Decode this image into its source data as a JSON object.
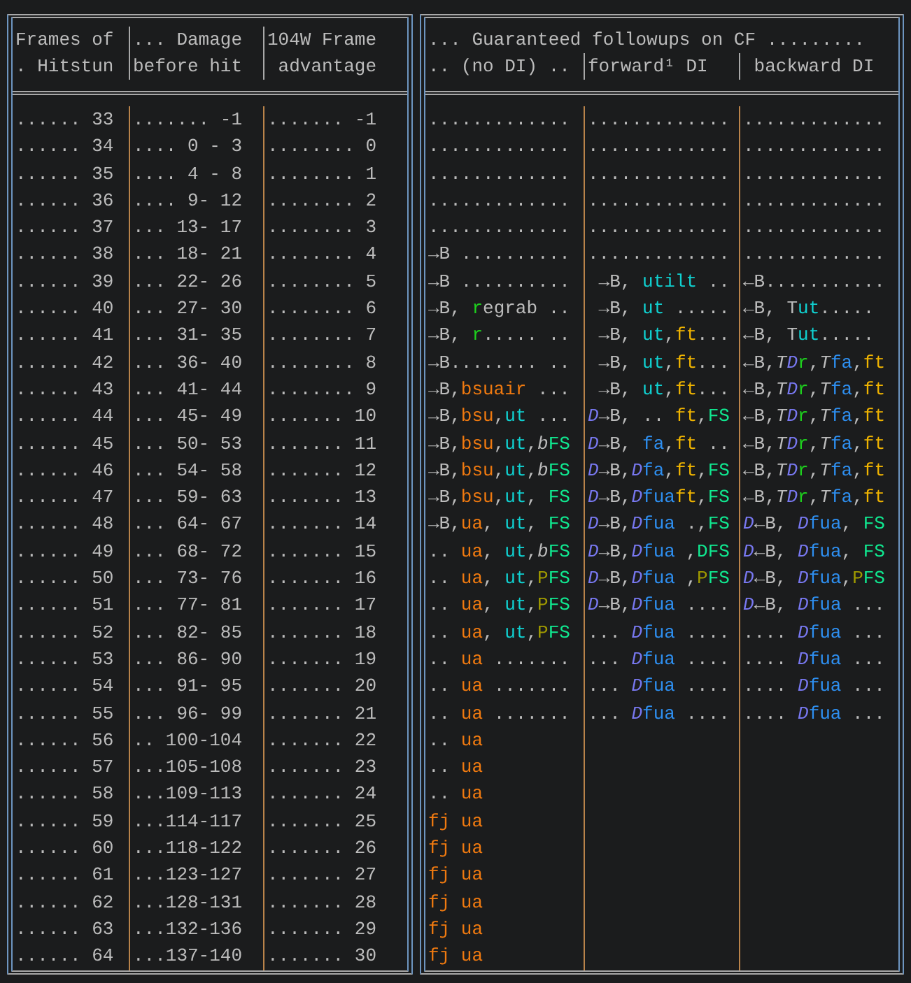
{
  "left_table": {
    "columns": [
      {
        "line_1": "Frames of",
        "line_2": ". Hitstun"
      },
      {
        "line_1": "... Damage",
        "line_2": "before hit"
      },
      {
        "line_1": "104W Frame",
        "line_2": " advantage"
      }
    ]
  },
  "right_table": {
    "title": "... Guaranteed followups on CF .........",
    "columns": [
      ".. (no DI) ..",
      "forward¹ DI",
      " backward DI"
    ]
  },
  "rows": [
    {
      "hitstun": "...... 33",
      "damage": "....... -1",
      "advantage": "....... -1",
      "no_di": [
        {
          "text": ".............",
          "color": "#bcbcbc"
        }
      ],
      "forward_di": [
        {
          "text": ".............",
          "color": "#bcbcbc"
        }
      ],
      "backward_di": [
        {
          "text": ".............",
          "color": "#bcbcbc"
        }
      ]
    },
    {
      "hitstun": "...... 34",
      "damage": ".... 0 - 3",
      "advantage": "........ 0",
      "no_di": [
        {
          "text": ".............",
          "color": "#bcbcbc"
        }
      ],
      "forward_di": [
        {
          "text": ".............",
          "color": "#bcbcbc"
        }
      ],
      "backward_di": [
        {
          "text": ".............",
          "color": "#bcbcbc"
        }
      ]
    },
    {
      "hitstun": "...... 35",
      "damage": ".... 4 - 8",
      "advantage": "........ 1",
      "no_di": [
        {
          "text": ".............",
          "color": "#bcbcbc"
        }
      ],
      "forward_di": [
        {
          "text": ".............",
          "color": "#bcbcbc"
        }
      ],
      "backward_di": [
        {
          "text": ".............",
          "color": "#bcbcbc"
        }
      ]
    },
    {
      "hitstun": "...... 36",
      "damage": ".... 9- 12",
      "advantage": "........ 2",
      "no_di": [
        {
          "text": ".............",
          "color": "#bcbcbc"
        }
      ],
      "forward_di": [
        {
          "text": ".............",
          "color": "#bcbcbc"
        }
      ],
      "backward_di": [
        {
          "text": ".............",
          "color": "#bcbcbc"
        }
      ]
    },
    {
      "hitstun": "...... 37",
      "damage": "... 13- 17",
      "advantage": "........ 3",
      "no_di": [
        {
          "text": ".............",
          "color": "#bcbcbc"
        }
      ],
      "forward_di": [
        {
          "text": ".............",
          "color": "#bcbcbc"
        }
      ],
      "backward_di": [
        {
          "text": ".............",
          "color": "#bcbcbc"
        }
      ]
    },
    {
      "hitstun": "...... 38",
      "damage": "... 18- 21",
      "advantage": "........ 4",
      "no_di": [
        {
          "text": "→B ..........",
          "color": "#bcbcbc"
        }
      ],
      "forward_di": [
        {
          "text": ".............",
          "color": "#bcbcbc"
        }
      ],
      "backward_di": [
        {
          "text": ".............",
          "color": "#bcbcbc"
        }
      ]
    },
    {
      "hitstun": "...... 39",
      "damage": "... 22- 26",
      "advantage": "........ 5",
      "no_di": [
        {
          "text": "→B ..........",
          "color": "#bcbcbc"
        }
      ],
      "forward_di": [
        {
          "text": " →B, ",
          "color": "#bcbcbc"
        },
        {
          "text": "utilt",
          "color": "#10d0d0"
        },
        {
          "text": " ..",
          "color": "#bcbcbc"
        }
      ],
      "backward_di": [
        {
          "text": "←B...........",
          "color": "#bcbcbc"
        }
      ]
    },
    {
      "hitstun": "...... 40",
      "damage": "... 27- 30",
      "advantage": "........ 6",
      "no_di": [
        {
          "text": "→B, ",
          "color": "#bcbcbc"
        },
        {
          "text": "r",
          "color": "#1ed01e"
        },
        {
          "text": "egrab ..",
          "color": "#bcbcbc"
        }
      ],
      "forward_di": [
        {
          "text": " →B, ",
          "color": "#bcbcbc"
        },
        {
          "text": "ut",
          "color": "#10d0d0"
        },
        {
          "text": " .....",
          "color": "#bcbcbc"
        }
      ],
      "backward_di": [
        {
          "text": "←B, T",
          "color": "#bcbcbc"
        },
        {
          "text": "ut",
          "color": "#10d0d0"
        },
        {
          "text": ".....",
          "color": "#bcbcbc"
        }
      ]
    },
    {
      "hitstun": "...... 41",
      "damage": "... 31- 35",
      "advantage": "........ 7",
      "no_di": [
        {
          "text": "→B, ",
          "color": "#bcbcbc"
        },
        {
          "text": "r",
          "color": "#1ed01e"
        },
        {
          "text": "..... ..",
          "color": "#bcbcbc"
        }
      ],
      "forward_di": [
        {
          "text": " →B, ",
          "color": "#bcbcbc"
        },
        {
          "text": "ut",
          "color": "#10d0d0"
        },
        {
          "text": ",",
          "color": "#bcbcbc"
        },
        {
          "text": "ft",
          "color": "#f0b400"
        },
        {
          "text": "...",
          "color": "#bcbcbc"
        }
      ],
      "backward_di": [
        {
          "text": "←B, T",
          "color": "#bcbcbc"
        },
        {
          "text": "ut",
          "color": "#10d0d0"
        },
        {
          "text": ".....",
          "color": "#bcbcbc"
        }
      ]
    },
    {
      "hitstun": "...... 42",
      "damage": "... 36- 40",
      "advantage": "........ 8",
      "no_di": [
        {
          "text": "→B........ ..",
          "color": "#bcbcbc"
        }
      ],
      "forward_di": [
        {
          "text": " →B, ",
          "color": "#bcbcbc"
        },
        {
          "text": "ut",
          "color": "#10d0d0"
        },
        {
          "text": ",",
          "color": "#bcbcbc"
        },
        {
          "text": "ft",
          "color": "#f0b400"
        },
        {
          "text": "...",
          "color": "#bcbcbc"
        }
      ],
      "backward_di": [
        {
          "text": "←B,*T*",
          "color": "#bcbcbc"
        },
        {
          "text": "*D*",
          "color": "#7878f0"
        },
        {
          "text": "r",
          "color": "#1ed01e"
        },
        {
          "text": ",*T*",
          "color": "#bcbcbc"
        },
        {
          "text": "fa",
          "color": "#2e8ff0"
        },
        {
          "text": ",",
          "color": "#bcbcbc"
        },
        {
          "text": "ft",
          "color": "#f0b400"
        }
      ]
    },
    {
      "hitstun": "...... 43",
      "damage": "... 41- 44",
      "advantage": "........ 9",
      "no_di": [
        {
          "text": "→B,",
          "color": "#bcbcbc"
        },
        {
          "text": "bsuair",
          "color": "#f07a10"
        },
        {
          "text": " ...",
          "color": "#bcbcbc"
        }
      ],
      "forward_di": [
        {
          "text": " →B, ",
          "color": "#bcbcbc"
        },
        {
          "text": "ut",
          "color": "#10d0d0"
        },
        {
          "text": ",",
          "color": "#bcbcbc"
        },
        {
          "text": "ft",
          "color": "#f0b400"
        },
        {
          "text": "...",
          "color": "#bcbcbc"
        }
      ],
      "backward_di": [
        {
          "text": "←B,*T*",
          "color": "#bcbcbc"
        },
        {
          "text": "*D*",
          "color": "#7878f0"
        },
        {
          "text": "r",
          "color": "#1ed01e"
        },
        {
          "text": ",*T*",
          "color": "#bcbcbc"
        },
        {
          "text": "fa",
          "color": "#2e8ff0"
        },
        {
          "text": ",",
          "color": "#bcbcbc"
        },
        {
          "text": "ft",
          "color": "#f0b400"
        }
      ]
    },
    {
      "hitstun": "...... 44",
      "damage": "... 45- 49",
      "advantage": "....... 10",
      "no_di": [
        {
          "text": "→B,",
          "color": "#bcbcbc"
        },
        {
          "text": "bsu",
          "color": "#f07a10"
        },
        {
          "text": ",",
          "color": "#bcbcbc"
        },
        {
          "text": "ut",
          "color": "#10d0d0"
        },
        {
          "text": " ...",
          "color": "#bcbcbc"
        }
      ],
      "forward_di": [
        {
          "text": "*D*",
          "color": "#7878f0"
        },
        {
          "text": "→B, .. ",
          "color": "#bcbcbc"
        },
        {
          "text": "ft",
          "color": "#f0b400"
        },
        {
          "text": ",",
          "color": "#bcbcbc"
        },
        {
          "text": "FS",
          "color": "#10e890"
        }
      ],
      "backward_di": [
        {
          "text": "←B,*T*",
          "color": "#bcbcbc"
        },
        {
          "text": "*D*",
          "color": "#7878f0"
        },
        {
          "text": "r",
          "color": "#1ed01e"
        },
        {
          "text": ",*T*",
          "color": "#bcbcbc"
        },
        {
          "text": "fa",
          "color": "#2e8ff0"
        },
        {
          "text": ",",
          "color": "#bcbcbc"
        },
        {
          "text": "ft",
          "color": "#f0b400"
        }
      ]
    },
    {
      "hitstun": "...... 45",
      "damage": "... 50- 53",
      "advantage": "....... 11",
      "no_di": [
        {
          "text": "→B,",
          "color": "#bcbcbc"
        },
        {
          "text": "bsu",
          "color": "#f07a10"
        },
        {
          "text": ",",
          "color": "#bcbcbc"
        },
        {
          "text": "ut",
          "color": "#10d0d0"
        },
        {
          "text": ",*b*",
          "color": "#bcbcbc"
        },
        {
          "text": "FS",
          "color": "#10e890"
        }
      ],
      "forward_di": [
        {
          "text": "*D*",
          "color": "#7878f0"
        },
        {
          "text": "→B, ",
          "color": "#bcbcbc"
        },
        {
          "text": "fa",
          "color": "#2e8ff0"
        },
        {
          "text": ",",
          "color": "#bcbcbc"
        },
        {
          "text": "ft",
          "color": "#f0b400"
        },
        {
          "text": " ..",
          "color": "#bcbcbc"
        }
      ],
      "backward_di": [
        {
          "text": "←B,*T*",
          "color": "#bcbcbc"
        },
        {
          "text": "*D*",
          "color": "#7878f0"
        },
        {
          "text": "r",
          "color": "#1ed01e"
        },
        {
          "text": ",*T*",
          "color": "#bcbcbc"
        },
        {
          "text": "fa",
          "color": "#2e8ff0"
        },
        {
          "text": ",",
          "color": "#bcbcbc"
        },
        {
          "text": "ft",
          "color": "#f0b400"
        }
      ]
    },
    {
      "hitstun": "...... 46",
      "damage": "... 54- 58",
      "advantage": "....... 12",
      "no_di": [
        {
          "text": "→B,",
          "color": "#bcbcbc"
        },
        {
          "text": "bsu",
          "color": "#f07a10"
        },
        {
          "text": ",",
          "color": "#bcbcbc"
        },
        {
          "text": "ut",
          "color": "#10d0d0"
        },
        {
          "text": ",*b*",
          "color": "#bcbcbc"
        },
        {
          "text": "FS",
          "color": "#10e890"
        }
      ],
      "forward_di": [
        {
          "text": "*D*",
          "color": "#7878f0"
        },
        {
          "text": "→B,",
          "color": "#bcbcbc"
        },
        {
          "text": "*D*",
          "color": "#7878f0"
        },
        {
          "text": "fa",
          "color": "#2e8ff0"
        },
        {
          "text": ",",
          "color": "#bcbcbc"
        },
        {
          "text": "ft",
          "color": "#f0b400"
        },
        {
          "text": ",",
          "color": "#bcbcbc"
        },
        {
          "text": "FS",
          "color": "#10e890"
        }
      ],
      "backward_di": [
        {
          "text": "←B,*T*",
          "color": "#bcbcbc"
        },
        {
          "text": "*D*",
          "color": "#7878f0"
        },
        {
          "text": "r",
          "color": "#1ed01e"
        },
        {
          "text": ",*T*",
          "color": "#bcbcbc"
        },
        {
          "text": "fa",
          "color": "#2e8ff0"
        },
        {
          "text": ",",
          "color": "#bcbcbc"
        },
        {
          "text": "ft",
          "color": "#f0b400"
        }
      ]
    },
    {
      "hitstun": "...... 47",
      "damage": "... 59- 63",
      "advantage": "....... 13",
      "no_di": [
        {
          "text": "→B,",
          "color": "#bcbcbc"
        },
        {
          "text": "bsu",
          "color": "#f07a10"
        },
        {
          "text": ",",
          "color": "#bcbcbc"
        },
        {
          "text": "ut",
          "color": "#10d0d0"
        },
        {
          "text": ", ",
          "color": "#bcbcbc"
        },
        {
          "text": "FS",
          "color": "#10e890"
        }
      ],
      "forward_di": [
        {
          "text": "*D*",
          "color": "#7878f0"
        },
        {
          "text": "→B,",
          "color": "#bcbcbc"
        },
        {
          "text": "*D*",
          "color": "#7878f0"
        },
        {
          "text": "fua",
          "color": "#2e8ff0"
        },
        {
          "text": "ft",
          "color": "#f0b400"
        },
        {
          "text": ",",
          "color": "#bcbcbc"
        },
        {
          "text": "FS",
          "color": "#10e890"
        }
      ],
      "backward_di": [
        {
          "text": "←B,*T*",
          "color": "#bcbcbc"
        },
        {
          "text": "*D*",
          "color": "#7878f0"
        },
        {
          "text": "r",
          "color": "#1ed01e"
        },
        {
          "text": ",*T*",
          "color": "#bcbcbc"
        },
        {
          "text": "fa",
          "color": "#2e8ff0"
        },
        {
          "text": ",",
          "color": "#bcbcbc"
        },
        {
          "text": "ft",
          "color": "#f0b400"
        }
      ]
    },
    {
      "hitstun": "...... 48",
      "damage": "... 64- 67",
      "advantage": "....... 14",
      "no_di": [
        {
          "text": "→B,",
          "color": "#bcbcbc"
        },
        {
          "text": "ua",
          "color": "#f07a10"
        },
        {
          "text": ", ",
          "color": "#bcbcbc"
        },
        {
          "text": "ut",
          "color": "#10d0d0"
        },
        {
          "text": ", ",
          "color": "#bcbcbc"
        },
        {
          "text": "FS",
          "color": "#10e890"
        }
      ],
      "forward_di": [
        {
          "text": "*D*",
          "color": "#7878f0"
        },
        {
          "text": "→B,",
          "color": "#bcbcbc"
        },
        {
          "text": "*D*",
          "color": "#7878f0"
        },
        {
          "text": "fua",
          "color": "#2e8ff0"
        },
        {
          "text": " .,",
          "color": "#bcbcbc"
        },
        {
          "text": "FS",
          "color": "#10e890"
        }
      ],
      "backward_di": [
        {
          "text": "*D*",
          "color": "#7878f0"
        },
        {
          "text": "←B, ",
          "color": "#bcbcbc"
        },
        {
          "text": "*D*",
          "color": "#7878f0"
        },
        {
          "text": "fua",
          "color": "#2e8ff0"
        },
        {
          "text": ", ",
          "color": "#bcbcbc"
        },
        {
          "text": "FS",
          "color": "#10e890"
        }
      ]
    },
    {
      "hitstun": "...... 49",
      "damage": "... 68- 72",
      "advantage": "....... 15",
      "no_di": [
        {
          "text": ".. ",
          "color": "#bcbcbc"
        },
        {
          "text": "ua",
          "color": "#f07a10"
        },
        {
          "text": ", ",
          "color": "#bcbcbc"
        },
        {
          "text": "ut",
          "color": "#10d0d0"
        },
        {
          "text": ",*b*",
          "color": "#bcbcbc"
        },
        {
          "text": "FS",
          "color": "#10e890"
        }
      ],
      "forward_di": [
        {
          "text": "*D*",
          "color": "#7878f0"
        },
        {
          "text": "→B,",
          "color": "#bcbcbc"
        },
        {
          "text": "*D*",
          "color": "#7878f0"
        },
        {
          "text": "fua",
          "color": "#2e8ff0"
        },
        {
          "text": " ,",
          "color": "#bcbcbc"
        },
        {
          "text": "DFS",
          "color": "#10e890"
        }
      ],
      "backward_di": [
        {
          "text": "*D*",
          "color": "#7878f0"
        },
        {
          "text": "←B, ",
          "color": "#bcbcbc"
        },
        {
          "text": "*D*",
          "color": "#7878f0"
        },
        {
          "text": "fua",
          "color": "#2e8ff0"
        },
        {
          "text": ", ",
          "color": "#bcbcbc"
        },
        {
          "text": "FS",
          "color": "#10e890"
        }
      ]
    },
    {
      "hitstun": "...... 50",
      "damage": "... 73- 76",
      "advantage": "....... 16",
      "no_di": [
        {
          "text": ".. ",
          "color": "#bcbcbc"
        },
        {
          "text": "ua",
          "color": "#f07a10"
        },
        {
          "text": ", ",
          "color": "#bcbcbc"
        },
        {
          "text": "ut",
          "color": "#10d0d0"
        },
        {
          "text": ",",
          "color": "#bcbcbc"
        },
        {
          "text": "P",
          "color": "#a09a00"
        },
        {
          "text": "FS",
          "color": "#10e890"
        }
      ],
      "forward_di": [
        {
          "text": "*D*",
          "color": "#7878f0"
        },
        {
          "text": "→B,",
          "color": "#bcbcbc"
        },
        {
          "text": "*D*",
          "color": "#7878f0"
        },
        {
          "text": "fua",
          "color": "#2e8ff0"
        },
        {
          "text": " ,",
          "color": "#bcbcbc"
        },
        {
          "text": "P",
          "color": "#a09a00"
        },
        {
          "text": "FS",
          "color": "#10e890"
        }
      ],
      "backward_di": [
        {
          "text": "*D*",
          "color": "#7878f0"
        },
        {
          "text": "←B, ",
          "color": "#bcbcbc"
        },
        {
          "text": "*D*",
          "color": "#7878f0"
        },
        {
          "text": "fua",
          "color": "#2e8ff0"
        },
        {
          "text": ",",
          "color": "#bcbcbc"
        },
        {
          "text": "P",
          "color": "#a09a00"
        },
        {
          "text": "FS",
          "color": "#10e890"
        }
      ]
    },
    {
      "hitstun": "...... 51",
      "damage": "... 77- 81",
      "advantage": "....... 17",
      "no_di": [
        {
          "text": ".. ",
          "color": "#bcbcbc"
        },
        {
          "text": "ua",
          "color": "#f07a10"
        },
        {
          "text": ", ",
          "color": "#bcbcbc"
        },
        {
          "text": "ut",
          "color": "#10d0d0"
        },
        {
          "text": ",",
          "color": "#bcbcbc"
        },
        {
          "text": "P",
          "color": "#a09a00"
        },
        {
          "text": "FS",
          "color": "#10e890"
        }
      ],
      "forward_di": [
        {
          "text": "*D*",
          "color": "#7878f0"
        },
        {
          "text": "→B,",
          "color": "#bcbcbc"
        },
        {
          "text": "*D*",
          "color": "#7878f0"
        },
        {
          "text": "fua",
          "color": "#2e8ff0"
        },
        {
          "text": " ....",
          "color": "#bcbcbc"
        }
      ],
      "backward_di": [
        {
          "text": "*D*",
          "color": "#7878f0"
        },
        {
          "text": "←B, ",
          "color": "#bcbcbc"
        },
        {
          "text": "*D*",
          "color": "#7878f0"
        },
        {
          "text": "fua",
          "color": "#2e8ff0"
        },
        {
          "text": " ...",
          "color": "#bcbcbc"
        }
      ]
    },
    {
      "hitstun": "...... 52",
      "damage": "... 82- 85",
      "advantage": "....... 18",
      "no_di": [
        {
          "text": ".. ",
          "color": "#bcbcbc"
        },
        {
          "text": "ua",
          "color": "#f07a10"
        },
        {
          "text": ", ",
          "color": "#bcbcbc"
        },
        {
          "text": "ut",
          "color": "#10d0d0"
        },
        {
          "text": ",",
          "color": "#bcbcbc"
        },
        {
          "text": "P",
          "color": "#a09a00"
        },
        {
          "text": "FS",
          "color": "#10e890"
        }
      ],
      "forward_di": [
        {
          "text": "... ",
          "color": "#bcbcbc"
        },
        {
          "text": "*D*",
          "color": "#7878f0"
        },
        {
          "text": "fua",
          "color": "#2e8ff0"
        },
        {
          "text": " ....",
          "color": "#bcbcbc"
        }
      ],
      "backward_di": [
        {
          "text": ".... ",
          "color": "#bcbcbc"
        },
        {
          "text": "*D*",
          "color": "#7878f0"
        },
        {
          "text": "fua",
          "color": "#2e8ff0"
        },
        {
          "text": " ...",
          "color": "#bcbcbc"
        }
      ]
    },
    {
      "hitstun": "...... 53",
      "damage": "... 86- 90",
      "advantage": "....... 19",
      "no_di": [
        {
          "text": ".. ",
          "color": "#bcbcbc"
        },
        {
          "text": "ua",
          "color": "#f07a10"
        },
        {
          "text": " .......",
          "color": "#bcbcbc"
        }
      ],
      "forward_di": [
        {
          "text": "... ",
          "color": "#bcbcbc"
        },
        {
          "text": "*D*",
          "color": "#7878f0"
        },
        {
          "text": "fua",
          "color": "#2e8ff0"
        },
        {
          "text": " ....",
          "color": "#bcbcbc"
        }
      ],
      "backward_di": [
        {
          "text": ".... ",
          "color": "#bcbcbc"
        },
        {
          "text": "*D*",
          "color": "#7878f0"
        },
        {
          "text": "fua",
          "color": "#2e8ff0"
        },
        {
          "text": " ...",
          "color": "#bcbcbc"
        }
      ]
    },
    {
      "hitstun": "...... 54",
      "damage": "... 91- 95",
      "advantage": "....... 20",
      "no_di": [
        {
          "text": ".. ",
          "color": "#bcbcbc"
        },
        {
          "text": "ua",
          "color": "#f07a10"
        },
        {
          "text": " .......",
          "color": "#bcbcbc"
        }
      ],
      "forward_di": [
        {
          "text": "... ",
          "color": "#bcbcbc"
        },
        {
          "text": "*D*",
          "color": "#7878f0"
        },
        {
          "text": "fua",
          "color": "#2e8ff0"
        },
        {
          "text": " ....",
          "color": "#bcbcbc"
        }
      ],
      "backward_di": [
        {
          "text": ".... ",
          "color": "#bcbcbc"
        },
        {
          "text": "*D*",
          "color": "#7878f0"
        },
        {
          "text": "fua",
          "color": "#2e8ff0"
        },
        {
          "text": " ...",
          "color": "#bcbcbc"
        }
      ]
    },
    {
      "hitstun": "...... 55",
      "damage": "... 96- 99",
      "advantage": "....... 21",
      "no_di": [
        {
          "text": ".. ",
          "color": "#bcbcbc"
        },
        {
          "text": "ua",
          "color": "#f07a10"
        },
        {
          "text": " .......",
          "color": "#bcbcbc"
        }
      ],
      "forward_di": [
        {
          "text": "... ",
          "color": "#bcbcbc"
        },
        {
          "text": "*D*",
          "color": "#7878f0"
        },
        {
          "text": "fua",
          "color": "#2e8ff0"
        },
        {
          "text": " ....",
          "color": "#bcbcbc"
        }
      ],
      "backward_di": [
        {
          "text": ".... ",
          "color": "#bcbcbc"
        },
        {
          "text": "*D*",
          "color": "#7878f0"
        },
        {
          "text": "fua",
          "color": "#2e8ff0"
        },
        {
          "text": " ...",
          "color": "#bcbcbc"
        }
      ]
    },
    {
      "hitstun": "...... 56",
      "damage": ".. 100-104",
      "advantage": "....... 22",
      "no_di": [
        {
          "text": ".. ",
          "color": "#bcbcbc"
        },
        {
          "text": "ua",
          "color": "#f07a10"
        }
      ],
      "forward_di": [],
      "backward_di": []
    },
    {
      "hitstun": "...... 57",
      "damage": "...105-108",
      "advantage": "....... 23",
      "no_di": [
        {
          "text": ".. ",
          "color": "#bcbcbc"
        },
        {
          "text": "ua",
          "color": "#f07a10"
        }
      ],
      "forward_di": [],
      "backward_di": []
    },
    {
      "hitstun": "...... 58",
      "damage": "...109-113",
      "advantage": "....... 24",
      "no_di": [
        {
          "text": ".. ",
          "color": "#bcbcbc"
        },
        {
          "text": "ua",
          "color": "#f07a10"
        }
      ],
      "forward_di": [],
      "backward_di": []
    },
    {
      "hitstun": "...... 59",
      "damage": "...114-117",
      "advantage": "....... 25",
      "no_di": [
        {
          "text": "fj ua",
          "color": "#f07a10"
        }
      ],
      "forward_di": [],
      "backward_di": []
    },
    {
      "hitstun": "...... 60",
      "damage": "...118-122",
      "advantage": "....... 26",
      "no_di": [
        {
          "text": "fj ua",
          "color": "#f07a10"
        }
      ],
      "forward_di": [],
      "backward_di": []
    },
    {
      "hitstun": "...... 61",
      "damage": "...123-127",
      "advantage": "....... 27",
      "no_di": [
        {
          "text": "fj ua",
          "color": "#f07a10"
        }
      ],
      "forward_di": [],
      "backward_di": []
    },
    {
      "hitstun": "...... 62",
      "damage": "...128-131",
      "advantage": "....... 28",
      "no_di": [
        {
          "text": "fj ua",
          "color": "#f07a10"
        }
      ],
      "forward_di": [],
      "backward_di": []
    },
    {
      "hitstun": "...... 63",
      "damage": "...132-136",
      "advantage": "....... 29",
      "no_di": [
        {
          "text": "fj ua",
          "color": "#f07a10"
        }
      ],
      "forward_di": [],
      "backward_di": []
    },
    {
      "hitstun": "...... 64",
      "damage": "...137-140",
      "advantage": "....... 30",
      "no_di": [
        {
          "text": "fj ua",
          "color": "#f07a10"
        }
      ],
      "forward_di": [],
      "backward_di": []
    }
  ]
}
